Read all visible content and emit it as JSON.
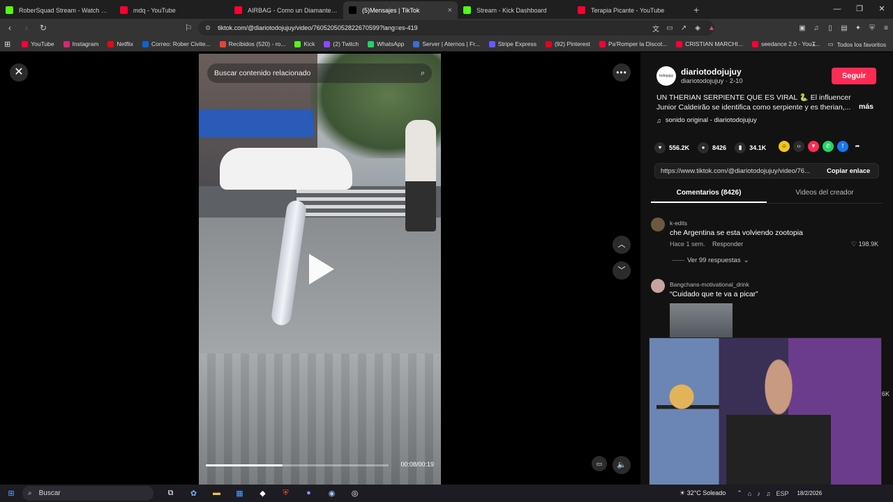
{
  "browser": {
    "tabs": [
      {
        "title": "RoberSquad Stream - Watch Live",
        "icon": "kick-icon",
        "color": "#53fc18",
        "active": false
      },
      {
        "title": "mdq - YouTube",
        "icon": "youtube-icon",
        "color": "#ff0033",
        "active": false
      },
      {
        "title": "AIRBAG - Como un Diamante - video",
        "icon": "youtube-icon",
        "color": "#ff0033",
        "active": false
      },
      {
        "title": "(5)Mensajes | TikTok",
        "icon": "tiktok-icon",
        "color": "#000000",
        "active": true
      },
      {
        "title": "Stream - Kick Dashboard",
        "icon": "kick-icon",
        "color": "#53fc18",
        "active": false
      },
      {
        "title": "Terapia Picante - YouTube",
        "icon": "youtube-icon",
        "color": "#ff0033",
        "active": false
      }
    ],
    "url": "tiktok.com/@diariotodojujuy/video/7605205052822670599?lang=es-419",
    "bookmarks": [
      {
        "label": "YouTube",
        "color": "#ff0033"
      },
      {
        "label": "Instagram",
        "color": "#d62976"
      },
      {
        "label": "Netflix",
        "color": "#e50914"
      },
      {
        "label": "Correo: Rober Civite...",
        "color": "#0a64d6"
      },
      {
        "label": "Recibidos (520) - ro...",
        "color": "#ea4335"
      },
      {
        "label": "Kick",
        "color": "#53fc18"
      },
      {
        "label": "(2) Twitch",
        "color": "#9146ff"
      },
      {
        "label": "WhatsApp",
        "color": "#25d366"
      },
      {
        "label": "Server | Aternos | Fr...",
        "color": "#3b6fd1"
      },
      {
        "label": "Stripe Express",
        "color": "#635bff"
      },
      {
        "label": "(92) Pinterest",
        "color": "#e60023"
      },
      {
        "label": "Pa'Romper la Discot...",
        "color": "#ff0033"
      },
      {
        "label": "CRISTIAN MARCHI...",
        "color": "#ff0033"
      },
      {
        "label": "seedance 2.0 - YouT...",
        "color": "#ff0033"
      }
    ],
    "bookmarks_right": "Todos los favoritos"
  },
  "video": {
    "search_placeholder": "Buscar contenido relacionado",
    "time": "00:08/00:19",
    "progress": 0.42
  },
  "post": {
    "avatar_text": "todojujuy",
    "username": "diariotodojujuy",
    "subline": "diariotodojujuy · 2-10",
    "follow_label": "Seguir",
    "description": "UN THERIAN SERPIENTE QUE ES VIRAL 🐍 El influencer Junior Caldeirão se identifica como serpiente y es therian,...",
    "more_label": "más",
    "sound": "sonido original - diariotodojujuy",
    "likes": "556.2K",
    "comments": "8426",
    "saves": "34.1K",
    "link": "https://www.tiktok.com/@diariotodojujuy/video/76...",
    "copy_label": "Copiar enlace"
  },
  "tabs": {
    "comments_label": "Comentarios (8426)",
    "creator_label": "Videos del creador"
  },
  "comments": [
    {
      "user": "k-edits",
      "text": "che Argentina se esta volviendo zootopia",
      "time": "Hace 1 sem.",
      "reply": "Responder",
      "likes": "198.9K",
      "replies": "Ver 99 respuestas"
    },
    {
      "user": "Bangchans-motivational_drink",
      "text": "“Cuidado que te va a picar”"
    }
  ],
  "side_count": "6K",
  "taskbar": {
    "search": "Buscar",
    "weather": "32°C Soleado",
    "lang": "ESP",
    "date": "18/2/2026"
  }
}
